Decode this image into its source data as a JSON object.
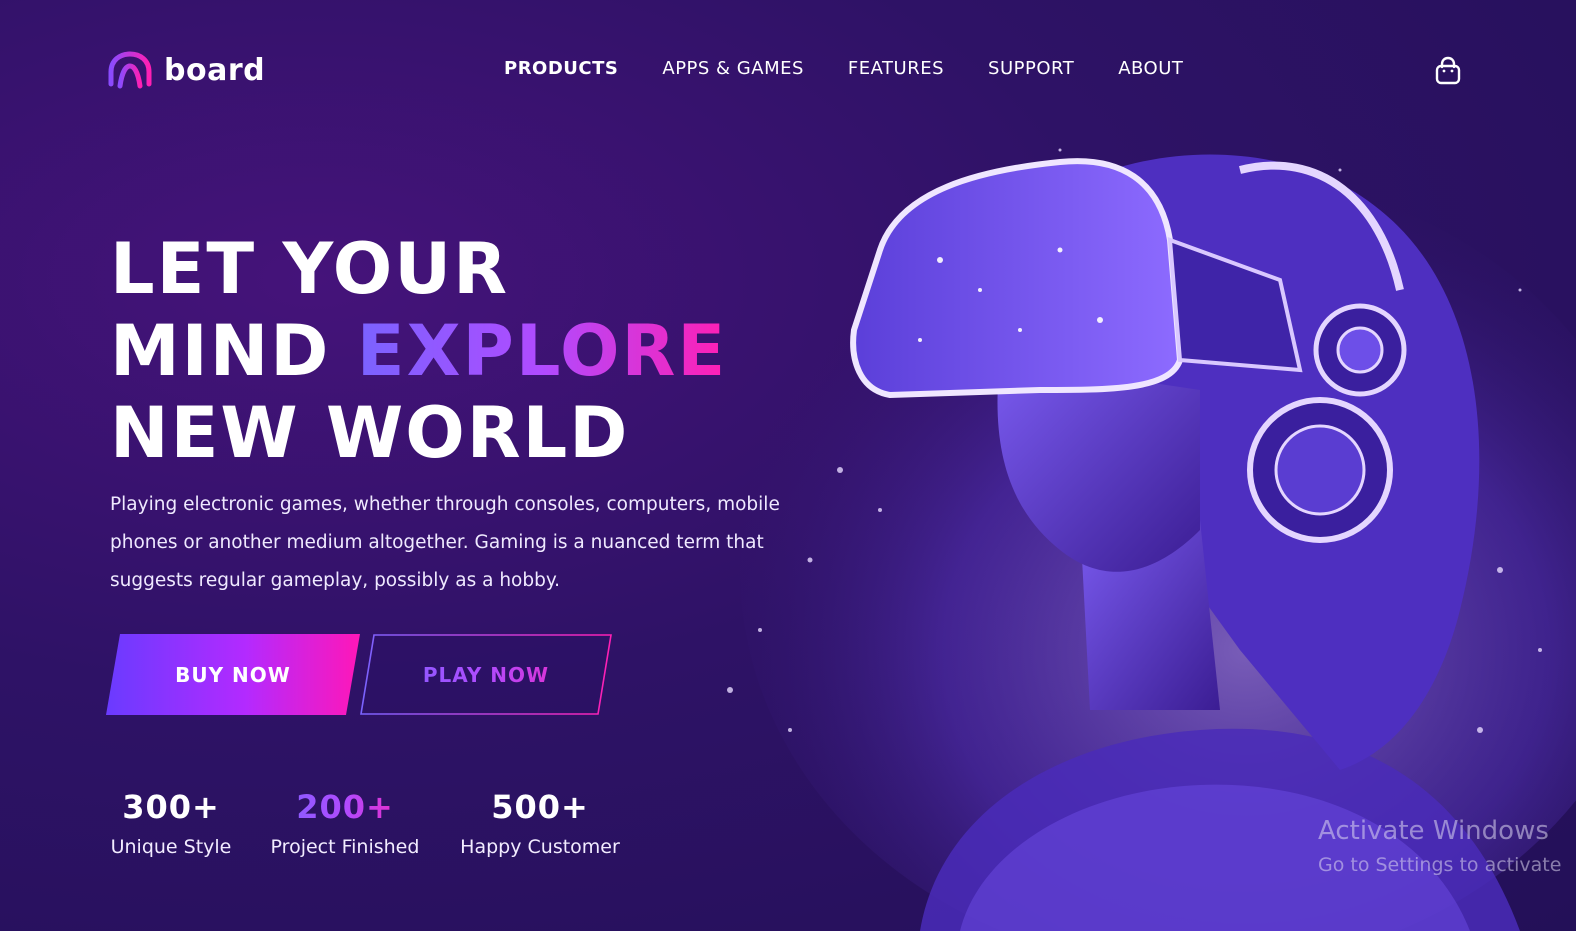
{
  "brand": {
    "name": "board"
  },
  "nav": {
    "items": [
      {
        "label": "PRODUCTS",
        "active": true
      },
      {
        "label": "APPS & GAMES"
      },
      {
        "label": "FEATURES"
      },
      {
        "label": "SUPPORT"
      },
      {
        "label": "ABOUT"
      }
    ],
    "cart_icon": "shopping-bag-icon"
  },
  "hero": {
    "line1": "LET YOUR",
    "line2_plain": "MIND ",
    "line2_accent": "EXPLORE",
    "line3": "NEW WORLD",
    "description": "Playing electronic games, whether through consoles, computers, mobile phones or another medium altogether. Gaming is a nuanced term that suggests regular gameplay, possibly as a hobby.",
    "buy_label": "BUY NOW",
    "play_label": "PLAY NOW",
    "image": "vr-headset-woman-illustration"
  },
  "stats": [
    {
      "number": "300+",
      "label": "Unique Style"
    },
    {
      "number": "200+",
      "label": "Project Finished"
    },
    {
      "number": "500+",
      "label": "Happy Customer"
    }
  ],
  "watermark": {
    "title": "Activate Windows",
    "subtitle": "Go to Settings to activate"
  },
  "colors": {
    "background": "#2e1266",
    "accent_purple": "#7a63ff",
    "accent_pink": "#ff1fb4",
    "glow": "#9b7bff"
  }
}
